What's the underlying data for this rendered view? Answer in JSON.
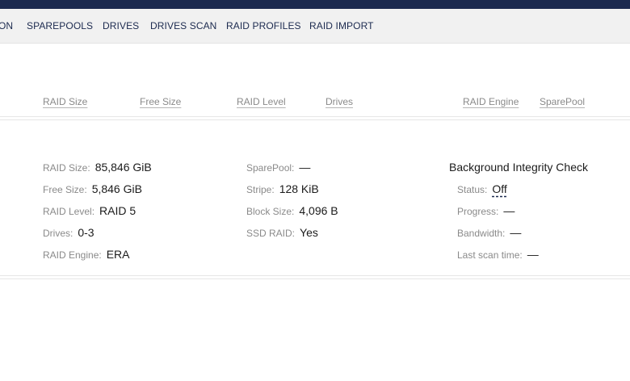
{
  "nav": {
    "items": [
      {
        "label": "ON"
      },
      {
        "label": "SPAREPOOLS"
      },
      {
        "label": "DRIVES"
      },
      {
        "label": "DRIVES SCAN"
      },
      {
        "label": "RAID PROFILES"
      },
      {
        "label": "RAID IMPORT"
      }
    ]
  },
  "table_header": {
    "raid_size": "RAID Size",
    "free_size": "Free Size",
    "raid_level": "RAID Level",
    "drives": "Drives",
    "raid_engine": "RAID Engine",
    "sparepool": "SparePool"
  },
  "details": {
    "left": [
      {
        "label": "RAID Size:",
        "value": "85,846 GiB"
      },
      {
        "label": "Free Size:",
        "value": "5,846 GiB"
      },
      {
        "label": "RAID Level:",
        "value": "RAID 5"
      },
      {
        "label": "Drives:",
        "value": "0-3"
      },
      {
        "label": "RAID Engine:",
        "value": "ERA"
      }
    ],
    "middle": [
      {
        "label": "SparePool:",
        "value": "—"
      },
      {
        "label": "Stripe:",
        "value": "128 KiB"
      },
      {
        "label": "Block Size:",
        "value": "4,096 B"
      },
      {
        "label": "SSD RAID:",
        "value": "Yes"
      }
    ],
    "integrity": {
      "title": "Background Integrity Check",
      "rows": [
        {
          "label": "Status:",
          "value": "Off"
        },
        {
          "label": "Progress:",
          "value": "—"
        },
        {
          "label": "Bandwidth:",
          "value": "—"
        },
        {
          "label": "Last scan time:",
          "value": "—"
        }
      ]
    }
  },
  "colors": {
    "topbar": "#1c2a4f",
    "nav_bg": "#f1f1f1",
    "label_gray": "#8a8a8a",
    "text_dark": "#1b1b1b"
  }
}
